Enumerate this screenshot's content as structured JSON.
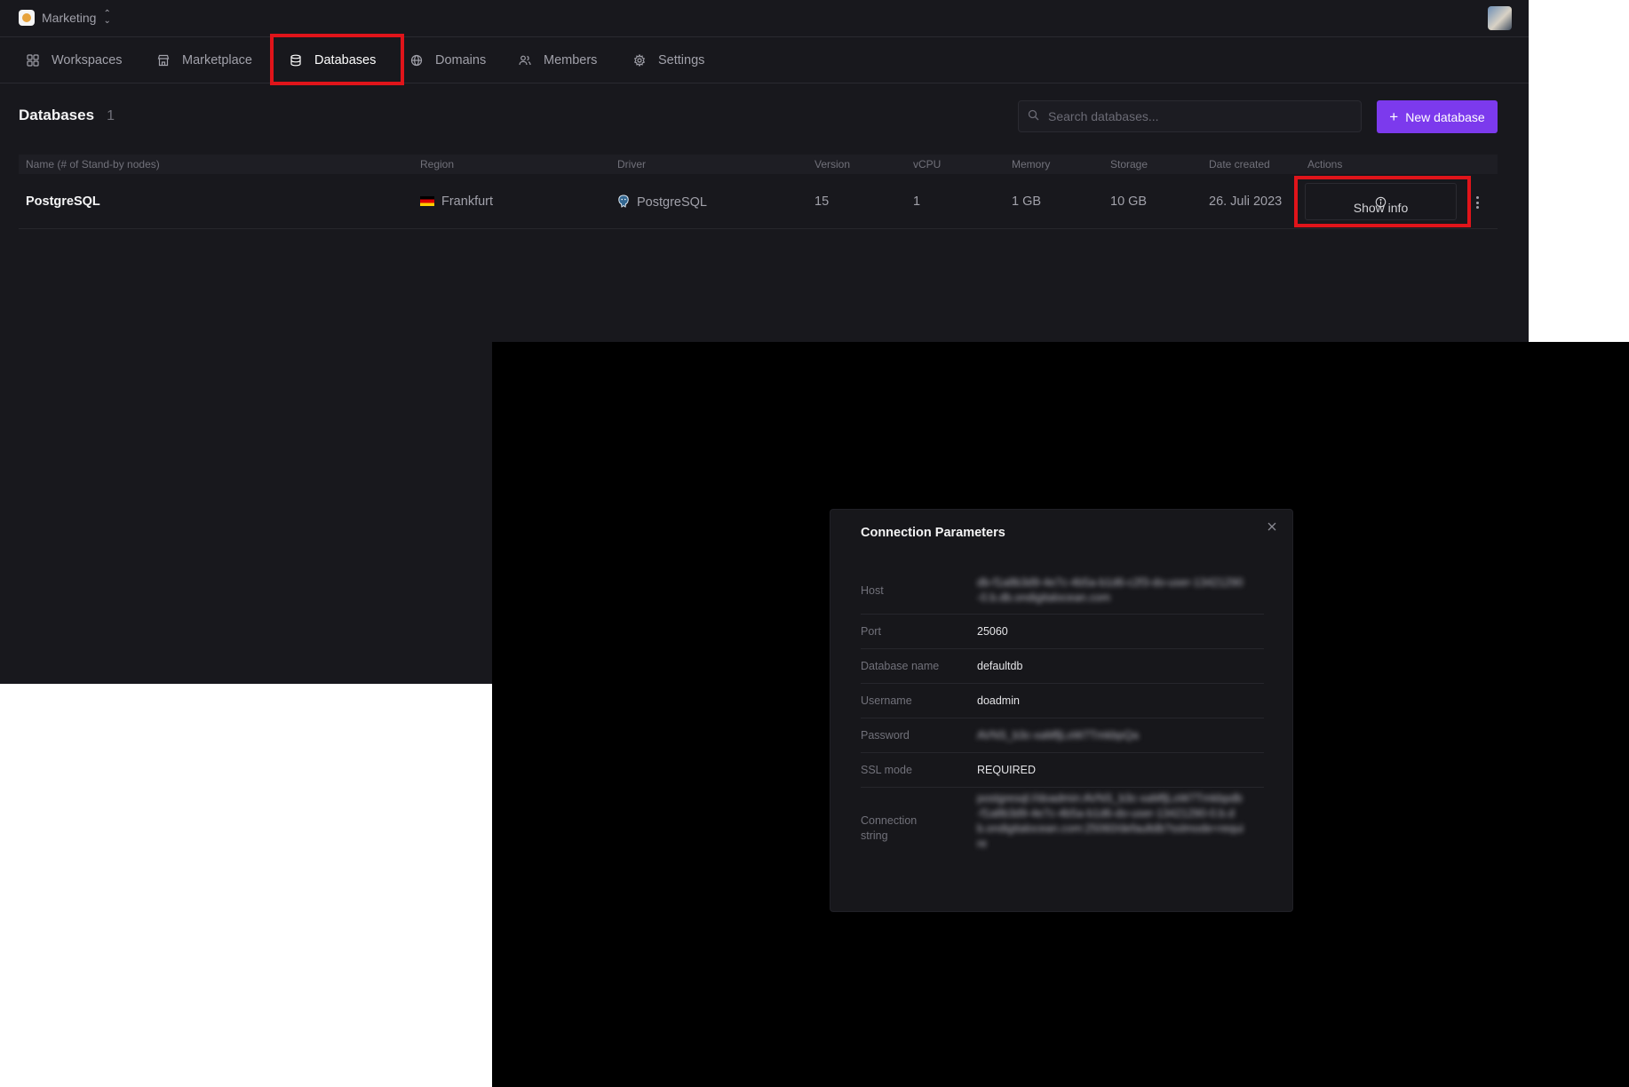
{
  "workspace": {
    "name": "Marketing"
  },
  "nav": {
    "items": [
      {
        "label": "Workspaces"
      },
      {
        "label": "Marketplace"
      },
      {
        "label": "Databases"
      },
      {
        "label": "Domains"
      },
      {
        "label": "Members"
      },
      {
        "label": "Settings"
      }
    ],
    "active": "Databases"
  },
  "page": {
    "title": "Databases",
    "count": "1",
    "search_placeholder": "Search databases...",
    "new_button_label": "New database"
  },
  "table": {
    "columns": [
      "Name (# of Stand-by nodes)",
      "Region",
      "Driver",
      "Version",
      "vCPU",
      "Memory",
      "Storage",
      "Date created",
      "Actions"
    ],
    "rows": [
      {
        "name": "PostgreSQL",
        "region": "Frankfurt",
        "driver": "PostgreSQL",
        "version": "15",
        "vcpu": "1",
        "memory": "1 GB",
        "storage": "10 GB",
        "date_created": "26. Juli 2023",
        "action_label": "Show info"
      }
    ]
  },
  "modal": {
    "title": "Connection Parameters",
    "params": [
      {
        "label": "Host",
        "value": "db-f1a8b3d9-4e7c-4b5a-b1d6-c2f3-do-user-13421290-0.b.db.ondigitalocean.com",
        "blurred": true
      },
      {
        "label": "Port",
        "value": "25060",
        "blurred": false
      },
      {
        "label": "Database name",
        "value": "defaultdb",
        "blurred": false
      },
      {
        "label": "Username",
        "value": "doadmin",
        "blurred": false
      },
      {
        "label": "Password",
        "value": "AVNS_b3c-xaMfjLoW7TmkbpQa",
        "blurred": true
      },
      {
        "label": "SSL mode",
        "value": "REQUIRED",
        "blurred": false
      },
      {
        "label": "Connection string",
        "value": "postgresql://doadmin:AVNS_b3c-xaMfjLoW7Tmkbpdb-f1a8b3d9-4e7c-4b5a-b1d6-do-user-13421290-0.b.db.ondigitalocean.com:25060/defaultdb?sslmode=require",
        "blurred": true
      }
    ]
  },
  "colors": {
    "accent": "#7c3aed",
    "highlight": "#e0141a",
    "background": "#18181d"
  }
}
